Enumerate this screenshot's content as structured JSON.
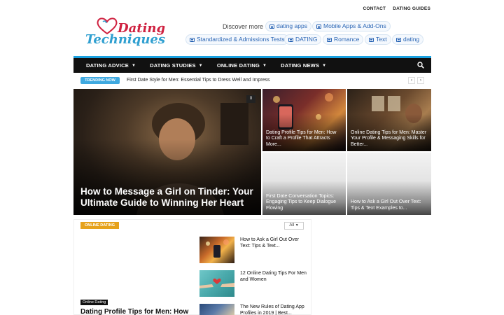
{
  "topbar": {
    "contact": "CONTACT",
    "dating_guides": "DATING GUIDES"
  },
  "logo": {
    "line1": "Dating",
    "line2": "Techniques"
  },
  "discover": "Discover more",
  "pills": [
    "dating apps",
    "Mobile Apps & Add-Ons",
    "Standardized & Admissions Tests",
    "DATING",
    "Romance",
    "Text",
    "dating"
  ],
  "nav": [
    "DATING ADVICE",
    "DATING STUDIES",
    "ONLINE DATING",
    "DATING NEWS"
  ],
  "trending": {
    "badge": "TRENDING NOW",
    "text": "First Date Style for Men: Essential Tips to Dress Well and Impress",
    "prev": "‹",
    "next": "›"
  },
  "hero": {
    "main_title": "How to Message a Girl on Tinder: Your Ultimate Guide to Winning Her Heart",
    "count": "0",
    "cards": [
      "Dating Profile Tips for Men: How to Craft a Profile That Attracts More...",
      "Online Dating Tips for Men: Master Your Profile & Messaging Skills for Better...",
      "First Date Conversation Topics: Engaging Tips to Keep Dialogue Flowing",
      "How to Ask a Girl Out Over Text: Tips & Text Examples to..."
    ]
  },
  "section": {
    "tag": "ONLINE DATING",
    "filter": "All",
    "feature_tag": "Online Dating",
    "feature_title": "Dating Profile Tips for Men: How",
    "list": [
      "How to Ask a Girl Out Over Text: Tips & Text...",
      "12 Online Dating Tips For Men and Women",
      "The New Rules of Dating App Profiles in 2019 | Best..."
    ]
  },
  "colors": {
    "accent": "#1aa1e0",
    "navbar": "#111111",
    "section_tag": "#e6a21c",
    "pill_text": "#2b66b5",
    "logo_red": "#cf2140",
    "logo_blue": "#2f9fd0"
  }
}
